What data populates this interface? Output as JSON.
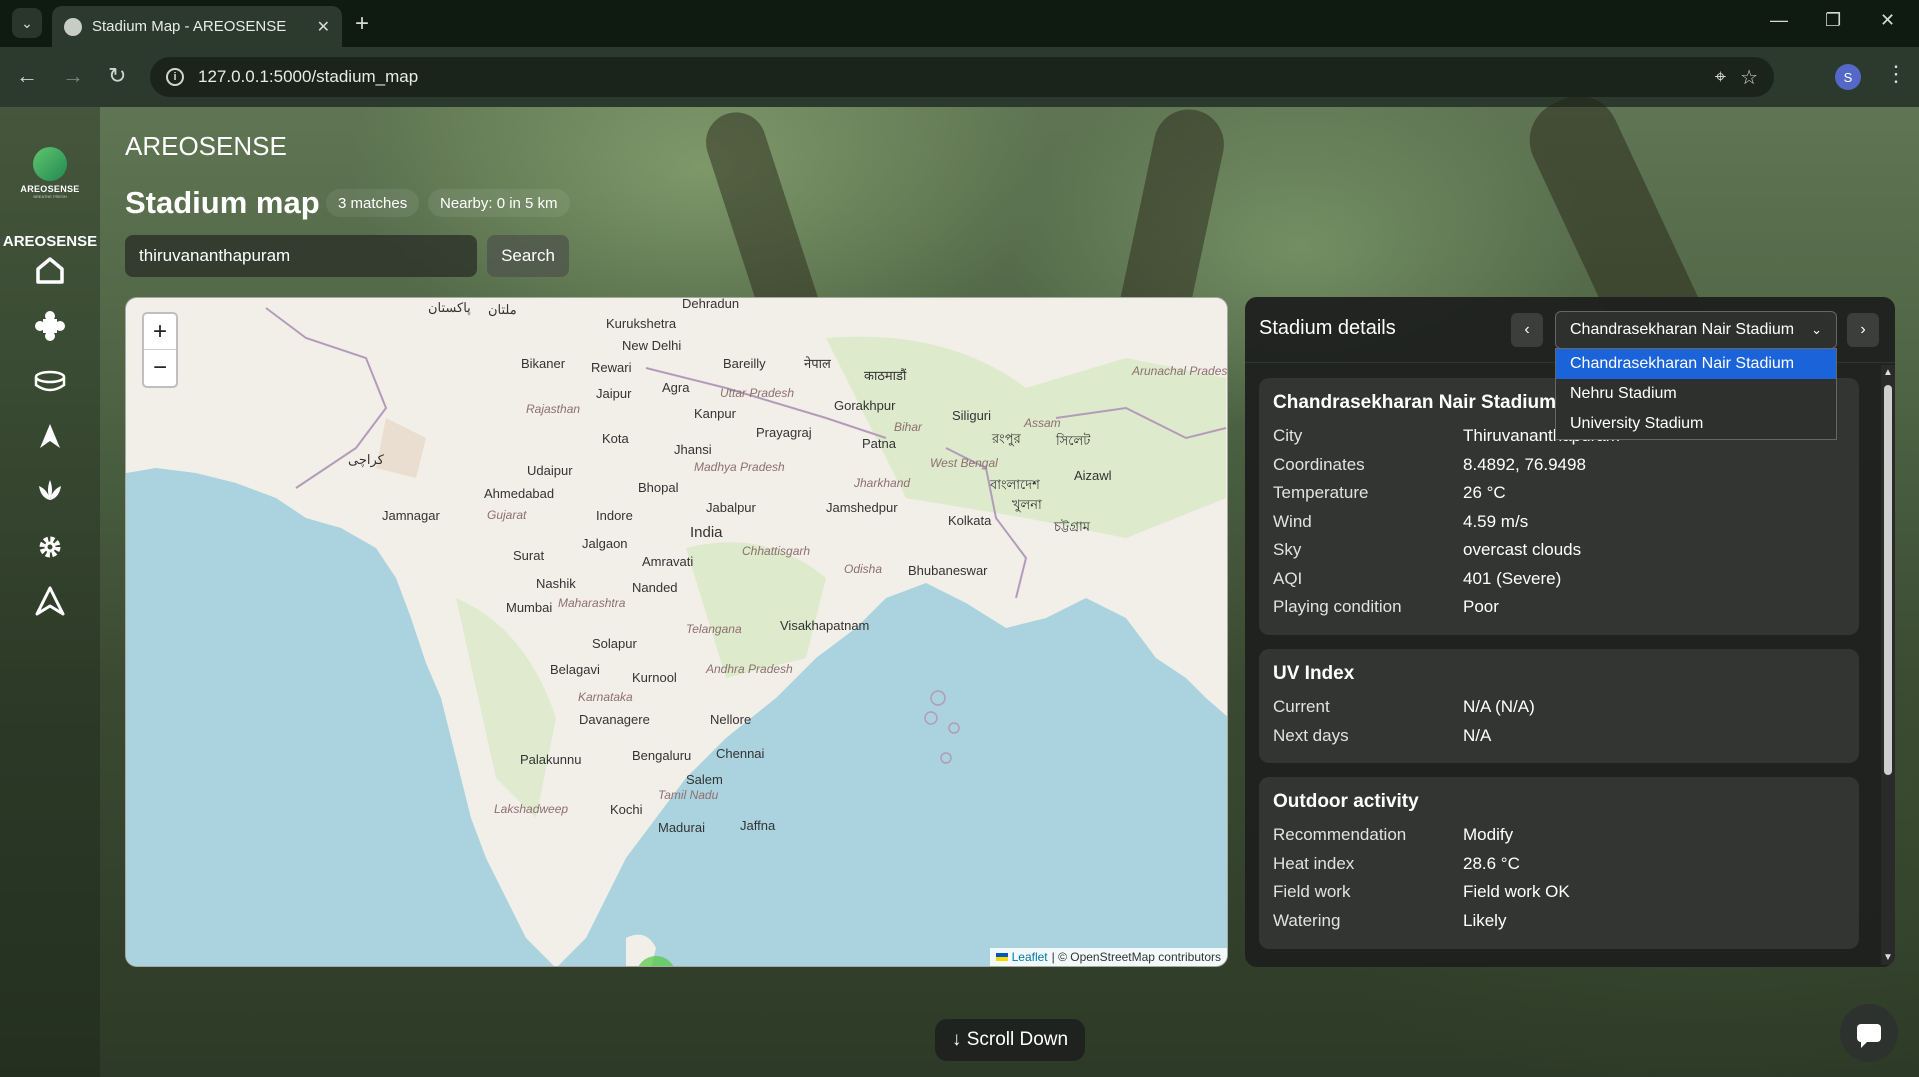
{
  "browser": {
    "tab_title": "Stadium Map - AREOSENSE",
    "url": "127.0.0.1:5000/stadium_map",
    "profile_initial": "S"
  },
  "sidebar": {
    "logo_text": "AREOSENSE",
    "logo_sub": "BREATHE FRESH",
    "title": "AREOSENSE",
    "icons": [
      "home-icon",
      "puzzle-icon",
      "stadium-icon",
      "navigation-icon",
      "lotus-icon",
      "gear-icon",
      "letter-a-icon"
    ]
  },
  "header": {
    "app_name": "AREOSENSE",
    "title": "Stadium map",
    "matches": "3 matches",
    "nearby": "Nearby: 0 in 5 km"
  },
  "search": {
    "value": "thiruvananthapuram",
    "button": "Search"
  },
  "map": {
    "zoom_in": "+",
    "zoom_out": "−",
    "attribution_link": "Leaflet",
    "attribution_text": "| © OpenStreetMap contributors",
    "labels": {
      "dehradun": "Dehradun",
      "kurukshetra": "Kurukshetra",
      "new_delhi": "New Delhi",
      "bikaner": "Bikaner",
      "rewari": "Rewari",
      "bareilly": "Bareilly",
      "jaipur": "Jaipur",
      "agra": "Agra",
      "kanpur": "Kanpur",
      "gorakhpur": "Gorakhpur",
      "siliguri": "Siliguri",
      "prayagraj": "Prayagraj",
      "kota": "Kota",
      "jhansi": "Jhansi",
      "patna": "Patna",
      "udaipur": "Udaipur",
      "ahmedabad": "Ahmedabad",
      "bhopal": "Bhopal",
      "jabalpur": "Jabalpur",
      "jamshedpur": "Jamshedpur",
      "kolkata": "Kolkata",
      "jamnagar": "Jamnagar",
      "indore": "Indore",
      "india": "India",
      "aizawl": "Aizawl",
      "surat": "Surat",
      "jalgaon": "Jalgaon",
      "amravati": "Amravati",
      "bhubaneswar": "Bhubaneswar",
      "nashik": "Nashik",
      "nanded": "Nanded",
      "mumbai": "Mumbai",
      "visakhapatnam": "Visakhapatnam",
      "solapur": "Solapur",
      "belagavi": "Belagavi",
      "kurnool": "Kurnool",
      "davanagere": "Davanagere",
      "nellore": "Nellore",
      "chennai": "Chennai",
      "bengaluru": "Bengaluru",
      "palakunnu": "Palakunnu",
      "salem": "Salem",
      "kochi": "Kochi",
      "madurai": "Madurai",
      "jaffna": "Jaffna",
      "rajasthan": "Rajasthan",
      "uttar_pradesh": "Uttar Pradesh",
      "madhya_pradesh": "Madhya\nPradesh",
      "bihar": "Bihar",
      "jharkhand": "Jharkhand",
      "west_bengal": "West Bengal",
      "gujarat": "Gujarat",
      "chhattisgarh": "Chhattisgarh",
      "odisha": "Odisha",
      "maharashtra": "Maharashtra",
      "telangana": "Telangana",
      "andhra_pradesh": "Andhra Pradesh",
      "karnataka": "Karnataka",
      "tamil_nadu": "Tamil Nadu",
      "lakshadweep": "Lakshadweep",
      "assam": "Assam",
      "arunachal_pradesh": "Arunachal Pradesh",
      "nepal": "नेपाल",
      "kathmandu": "काठमाडौं",
      "pakistan": "پاکستان",
      "multan": "ملتان",
      "karachi": "کراچی",
      "bangladesh": "বাংলাদেশ",
      "khulna": "খুলনা",
      "chittagong": "চট্টগ্রাম",
      "sylhet": "সিলেট",
      "rangpur": "রংপুর"
    }
  },
  "details": {
    "title": "Stadium details",
    "prev": "‹",
    "next": "›",
    "selected": "Chandrasekharan Nair Stadium",
    "options": [
      "Chandrasekharan Nair Stadium",
      "Nehru Stadium",
      "University Stadium"
    ],
    "stadium_card": {
      "title": "Chandrasekharan Nair Stadium",
      "rows": [
        {
          "k": "City",
          "v": "Thiruvananthapuram"
        },
        {
          "k": "Coordinates",
          "v": "8.4892, 76.9498"
        },
        {
          "k": "Temperature",
          "v": "26 °C"
        },
        {
          "k": "Wind",
          "v": "4.59 m/s"
        },
        {
          "k": "Sky",
          "v": "overcast clouds"
        },
        {
          "k": "AQI",
          "v": "401 (Severe)"
        },
        {
          "k": "Playing condition",
          "v": "Poor"
        }
      ]
    },
    "uv_card": {
      "title": "UV Index",
      "rows": [
        {
          "k": "Current",
          "v": "N/A (N/A)"
        },
        {
          "k": "Next days",
          "v": "N/A"
        }
      ]
    },
    "outdoor_card": {
      "title": "Outdoor activity",
      "rows": [
        {
          "k": "Recommendation",
          "v": "Modify"
        },
        {
          "k": "Heat index",
          "v": "28.6 °C"
        },
        {
          "k": "Field work",
          "v": "Field work OK"
        },
        {
          "k": "Watering",
          "v": "Likely"
        }
      ]
    }
  },
  "scroll_down": "↓ Scroll Down"
}
